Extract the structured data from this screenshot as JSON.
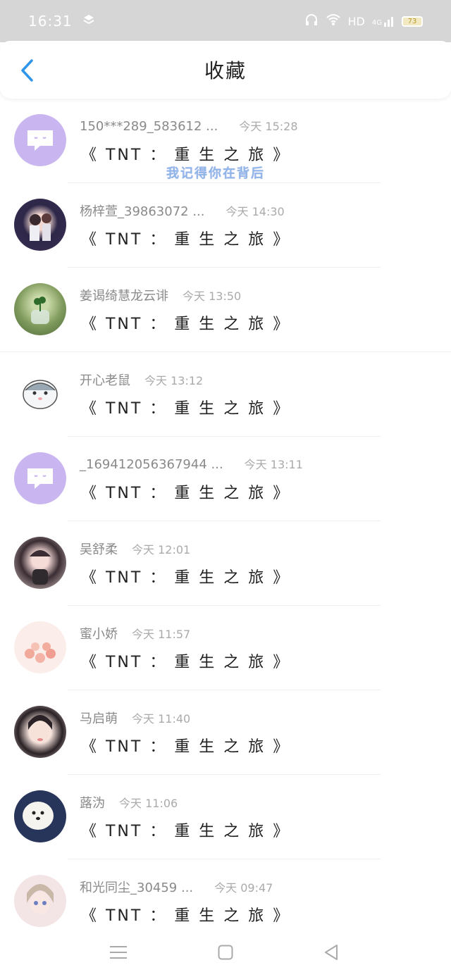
{
  "status_bar": {
    "time": "16:31",
    "network": "HD",
    "signal": "4G",
    "battery": "73"
  },
  "header": {
    "title": "收藏"
  },
  "signature": "我记得你在背后",
  "items": [
    {
      "name": "150***289_583612 ...",
      "time": "今天 15:28",
      "title": "《 TNT ： 重 生 之 旅 》"
    },
    {
      "name": "杨梓萱_39863072 ...",
      "time": "今天 14:30",
      "title": "《 TNT ： 重 生 之 旅 》"
    },
    {
      "name": "姜谒绮慧龙云诽",
      "time": "今天 13:50",
      "title": "《 TNT ： 重 生 之 旅 》"
    },
    {
      "name": "开心老鼠",
      "time": "今天 13:12",
      "title": "《 TNT ： 重 生 之 旅 》"
    },
    {
      "name": "_169412056367944 ...",
      "time": "今天 13:11",
      "title": "《 TNT ： 重 生 之 旅 》"
    },
    {
      "name": "吴舒柔",
      "time": "今天 12:01",
      "title": "《 TNT ： 重 生 之 旅 》"
    },
    {
      "name": "蜜小娇",
      "time": "今天 11:57",
      "title": "《 TNT ： 重 生 之 旅 》"
    },
    {
      "name": "马启萌",
      "time": "今天 11:40",
      "title": "《 TNT ： 重 生 之 旅 》"
    },
    {
      "name": "蕗沩",
      "time": "今天 11:06",
      "title": "《 TNT ： 重 生 之 旅 》"
    },
    {
      "name": "和光同尘_30459 ...",
      "time": "今天 09:47",
      "title": "《 TNT ： 重 生 之 旅 》"
    }
  ],
  "colors": {
    "accent": "#2f95e8",
    "default_avatar": "#c9b6f0"
  }
}
